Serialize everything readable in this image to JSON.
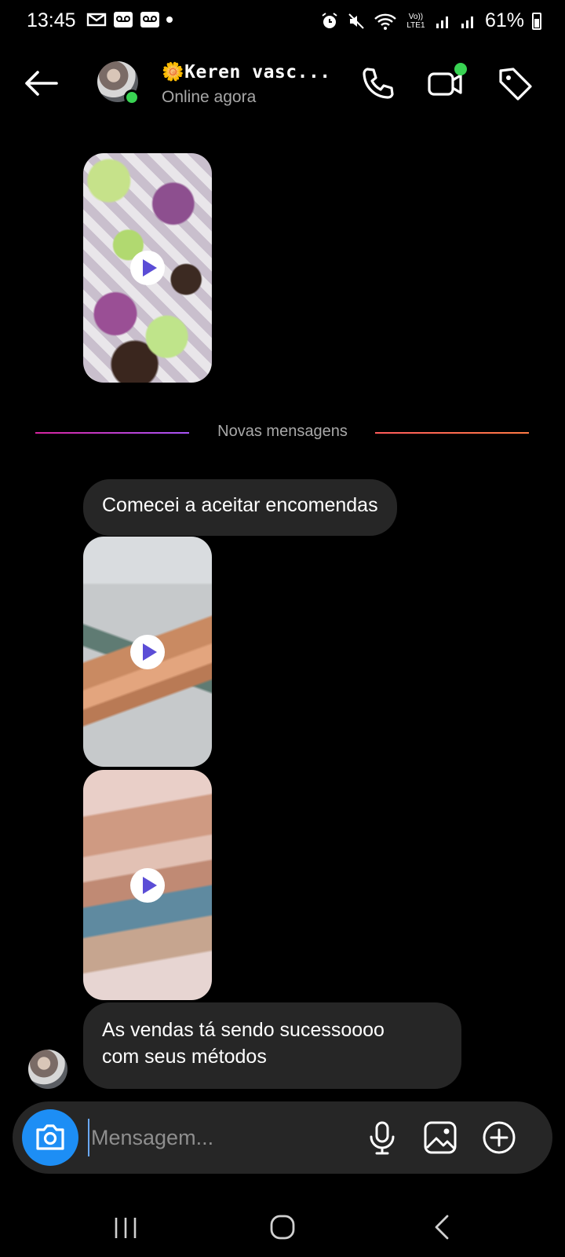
{
  "status_bar": {
    "time": "13:45",
    "battery": "61%",
    "network": "Vo)) LTE1"
  },
  "header": {
    "contact_name": "🌼Keren vasc...",
    "contact_status": "Online agora"
  },
  "messages": {
    "new_messages_divider": "Novas mensagens",
    "text_1": "Comecei a aceitar encomendas",
    "text_2_line1": "As vendas tá sendo sucessoooo",
    "text_2_line2": "com seus métodos"
  },
  "composer": {
    "placeholder": "Mensagem..."
  },
  "colors": {
    "background": "#000000",
    "bubble": "#262626",
    "online": "#39d353",
    "camera_button": "#1d8ef5",
    "play_icon": "#5b4dd6"
  },
  "icons": [
    "back-arrow-icon",
    "phone-icon",
    "video-call-icon",
    "tag-icon",
    "play-icon",
    "camera-icon",
    "microphone-icon",
    "gallery-icon",
    "plus-icon"
  ]
}
